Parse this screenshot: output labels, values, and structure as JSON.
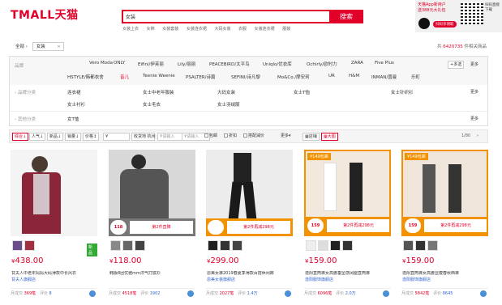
{
  "header": {
    "logo": "TMALL",
    "logo_cn": "天猫",
    "search_value": "女装",
    "search_btn": "搜索",
    "hotwords": [
      "女装上衣",
      "女棉",
      "女装套装",
      "女装连衣裙",
      "大码女装",
      "衣服",
      "女装连衣裙",
      "服装"
    ],
    "promo": {
      "line1": "天猫App新用户",
      "line2": "送388元大礼包",
      "btn": "扫码享领取",
      "qr_text": "扫码直接下载"
    }
  },
  "crumbs": {
    "all": "全部",
    "arrow": "›",
    "tag": "女装",
    "remove": "×"
  },
  "count": {
    "num": "6420735",
    "suffix": "件相关商品"
  },
  "attrs": {
    "brand_label": "品牌",
    "brands_row1": [
      "Vero Moda",
      "ONLY",
      "Eifini/伊芙丽",
      "Lily/丽丽",
      "PEACEBIRD/太平鸟",
      "Uniqlo/优衣库",
      "Ochirly/欧时力",
      "ZARA",
      "Five Plus"
    ],
    "brands_row2": [
      "HSTYLE/韩都衣舍",
      "音儿",
      "Teenie Weenie",
      "PSALTER/诗篇",
      "SEFINI/诗凡黎",
      "Mo&Co./摩安珂",
      "UR",
      "H&M",
      "INMAN/茵曼",
      "乐町"
    ],
    "highlight_brand": "音儿",
    "multi": "+多选",
    "more": "更多",
    "cat_label": "品牌分类",
    "cat_opts": [
      "连衣裙",
      "女士中老年服装",
      "大码女装",
      "女士T恤",
      "女士针织衫",
      "女士衬衫",
      "女士毛衣",
      "女士羽绒服"
    ],
    "other_label": "其他分类",
    "other_opts": [
      "女T恤"
    ]
  },
  "sort": {
    "items": [
      "综合",
      "人气",
      "新品",
      "销量",
      "价格"
    ],
    "price_from": "¥",
    "price_to": "¥",
    "location_label": "收货地",
    "location": "杭州",
    "placeholder1": "请输入",
    "placeholder2": "请输入",
    "filters": [
      "包邮",
      "折扣",
      "搭配减价"
    ],
    "more": "更多",
    "view_list": "店铺",
    "view_grid": "大图",
    "page": "1/80"
  },
  "products": [
    {
      "price": "438.00",
      "title": "甘夫人中老年妈妈大码薄款中长风衣",
      "shop": "甘夫人旗舰店",
      "sales_label": "月成交",
      "sales": "369笔",
      "reviews_label": "评价",
      "reviews": "8",
      "badge": "新品",
      "bg": "#a03040"
    },
    {
      "price": "118.00",
      "title": "韩版8团优雅mm洋气打底衫",
      "shop": "",
      "sales_label": "月成交",
      "sales": "4518笔",
      "reviews_label": "评价",
      "reviews": "1902",
      "banner_l": "118",
      "banner_r": "第2件直降",
      "bg": "#6b6b6b"
    },
    {
      "price": "299.00",
      "title": "恩美女裤2019春夏季薄款百搭休闲裤",
      "shop": "恩美女装旗舰店",
      "sales_label": "月成交",
      "sales": "2027笔",
      "reviews_label": "评价",
      "reviews": "1.4万",
      "banner_l": "",
      "banner_r": "第2件再减298元",
      "bg": "#e8e8e8"
    },
    {
      "price": "159.00",
      "title": "逸阳直筒裤女高腰垂坠感阔腿直筒裤",
      "shop": "逸阳服饰旗舰店",
      "sales_label": "月成交",
      "sales": "6096笔",
      "reviews_label": "评价",
      "reviews": "2.0万",
      "banner_l": "159",
      "banner_r": "第2件再减298元",
      "tag": "¥149包邮",
      "bg": "#f2e6d8"
    },
    {
      "price": "159.00",
      "title": "逸阳直筒裤女高腰显瘦春秋西裤",
      "shop": "逸阳服饰旗舰店",
      "sales_label": "月成交",
      "sales": "5842笔",
      "reviews_label": "评价",
      "reviews": "8645",
      "banner_l": "159",
      "banner_r": "第2件再减298元",
      "tag": "¥149包邮",
      "bg": "#ece2d6"
    }
  ]
}
